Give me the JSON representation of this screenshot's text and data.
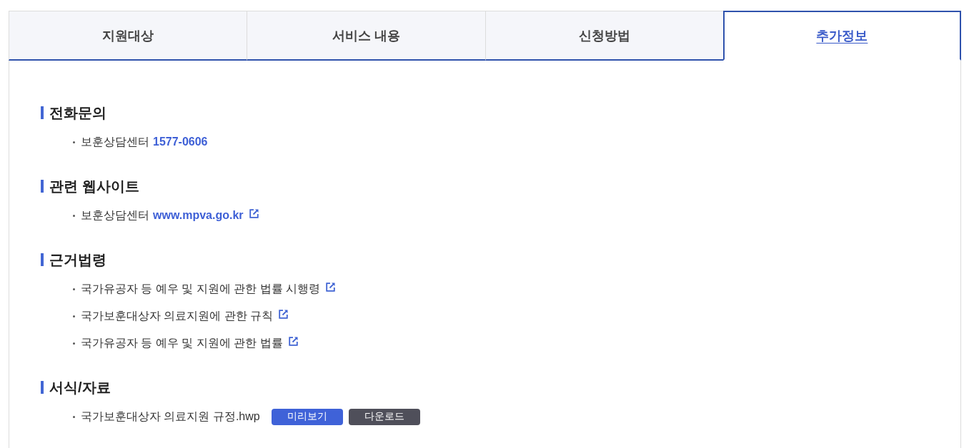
{
  "tabs": [
    {
      "label": "지원대상",
      "selected": false
    },
    {
      "label": "서비스 내용",
      "selected": false
    },
    {
      "label": "신청방법",
      "selected": false
    },
    {
      "label": "추가정보",
      "selected": true
    }
  ],
  "sections": [
    {
      "title": "전화문의",
      "items": [
        {
          "kind": "phone",
          "label": "보훈상담센터",
          "value": "1577-0606"
        }
      ]
    },
    {
      "title": "관련 웹사이트",
      "items": [
        {
          "kind": "website",
          "label": "보훈상담센터",
          "value": "www.mpva.go.kr"
        }
      ]
    },
    {
      "title": "근거법령",
      "items": [
        {
          "kind": "law",
          "label": "국가유공자 등 예우 및 지원에 관한 법률 시행령"
        },
        {
          "kind": "law",
          "label": "국가보훈대상자 의료지원에 관한 규칙"
        },
        {
          "kind": "law",
          "label": "국가유공자 등 예우 및 지원에 관한 법률"
        }
      ]
    },
    {
      "title": "서식/자료",
      "items": [
        {
          "kind": "file",
          "label": "국가보훈대상자 의료지원 규정.hwp",
          "buttons": [
            {
              "kind": "preview",
              "label": "미리보기"
            },
            {
              "kind": "download",
              "label": "다운로드"
            }
          ]
        }
      ]
    }
  ]
}
